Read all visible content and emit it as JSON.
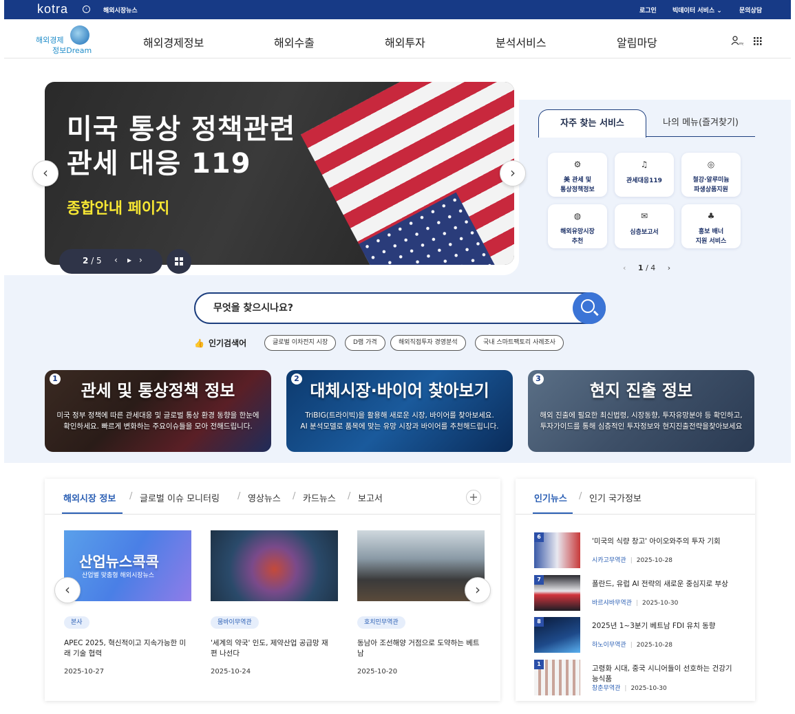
{
  "topbar": {
    "brand": "kotra",
    "sub_link": "해외시장뉴스",
    "login": "로그인",
    "bigdata": "빅데이터 서비스 ⌄",
    "inquiry": "문의상담"
  },
  "header": {
    "logo_line1": "해외경제",
    "logo_line2": "정보Dream",
    "nav": [
      "해외경제정보",
      "해외수출",
      "해외투자",
      "분석서비스",
      "알림마당"
    ]
  },
  "banner": {
    "title_line1": "미국 통상 정책관련",
    "title_line2": "관세 대응 119",
    "subtitle": "종합안내 페이지",
    "current": "2",
    "total": "/ 5",
    "prev": "‹",
    "pause": "▸",
    "next": "›"
  },
  "services": {
    "tab_active": "자주 찾는 서비스",
    "tab_other": "나의 메뉴(즐겨찾기)",
    "items": [
      {
        "label": "美 관세 및\n통상정책정보",
        "icon": "globe-person-icon"
      },
      {
        "label": "관세대응119",
        "icon": "siren-icon"
      },
      {
        "label": "철강·알루미늄\n파생상품지원",
        "icon": "coins-icon"
      },
      {
        "label": "해외유망시장\n추천",
        "icon": "big-data-icon"
      },
      {
        "label": "심층보고서",
        "icon": "report-icon"
      },
      {
        "label": "홍보 배너\n지원 서비스",
        "icon": "network-icon"
      }
    ],
    "pager_current": "1",
    "pager_total": "/ 4"
  },
  "search": {
    "placeholder": "무엇을 찾으시나요?",
    "popular_label": "인기검색어",
    "chips": [
      "글로벌 이차전지 시장",
      "D램 가격",
      "해외직접투자 경영분석",
      "국내 스마트팩토리 사례조사"
    ]
  },
  "promos": [
    {
      "num": "1",
      "title": "관세 및 통상정책 정보",
      "desc_line1": "미국 정부 정책에 따른 관세대응 및 글로벌 통상 환경 동향을 한눈에",
      "desc_line2": "확인하세요. 빠르게 변화하는 주요이슈들을 모아 전해드립니다."
    },
    {
      "num": "2",
      "title": "대체시장·바이어 찾아보기",
      "desc_line1": "TriBIG(트라이빅)을 활용해 새로운 시장, 바이어를 찾아보세요.",
      "desc_line2": "AI 분석모델로 품목에 맞는 유망 시장과 바이어를 추천해드립니다."
    },
    {
      "num": "3",
      "title": "현지 진출 정보",
      "desc_line1": "해외 진출에 필요한 최신법령, 시장동향, 투자유망분야 등 확인하고,",
      "desc_line2": "투자가이드를 통해 심층적인 투자정보와 현지진출전략을찾아보세요"
    }
  ],
  "market": {
    "tabs": [
      "해외시장 정보",
      "글로벌 이슈 모니터링",
      "영상뉴스",
      "카드뉴스",
      "보고서"
    ],
    "thumb1_title": "산업뉴스콕콕",
    "thumb1_sub": "산업별 맞춤형 해외시장뉴스",
    "cards": [
      {
        "tag": "본사",
        "title": "APEC 2025, 혁신적이고 지속가능한 미래 기술 협력",
        "date": "2025-10-27"
      },
      {
        "tag": "뭄바이무역관",
        "title": "'세계의 약국' 인도, 제약산업 공급망 재편 나선다",
        "date": "2025-10-24"
      },
      {
        "tag": "호치민무역관",
        "title": "동남아 조선해양 거점으로 도약하는 베트남",
        "date": "2025-10-20"
      }
    ]
  },
  "popular": {
    "tabs": [
      "인기뉴스",
      "인기 국가정보"
    ],
    "items": [
      {
        "rank": "6",
        "title": "'미국의 식량 창고' 아이오와주의 투자 기회",
        "org": "시카고무역관",
        "date": "2025-10-28"
      },
      {
        "rank": "7",
        "title": "폴란드, 유럽 AI 전략의 새로운 중심지로 부상",
        "org": "바르샤바무역관",
        "date": "2025-10-30"
      },
      {
        "rank": "8",
        "title": "2025년 1~3분기 베트남 FDI 유치 동향",
        "org": "하노이무역관",
        "date": "2025-10-28"
      },
      {
        "rank": "1",
        "title": "고령화 시대, 중국 시니어들이 선호하는 건강기능식품",
        "org": "창춘무역관",
        "date": "2025-10-30"
      }
    ]
  }
}
